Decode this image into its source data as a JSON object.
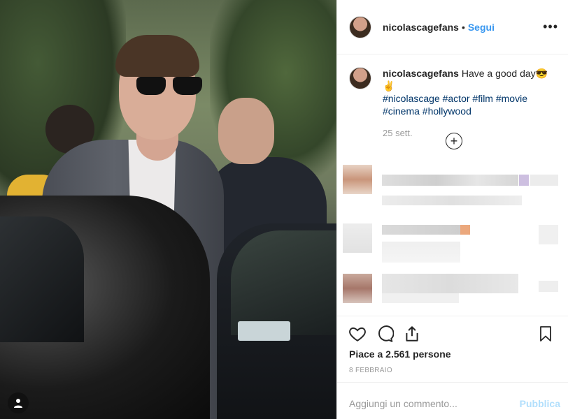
{
  "post": {
    "username": "nicolascagefans",
    "follow_dot": "•",
    "follow_label": "Segui",
    "more_label": "•••"
  },
  "caption": {
    "username": "nicolascagefans",
    "text": "Have a good day😎✌",
    "hashtags_line1": "#nicolascage #actor #film #movie",
    "hashtags_line2": "#cinema #hollywood",
    "date": "25 sett."
  },
  "engagement": {
    "likes": "Piace a 2.561 persone",
    "post_date": "8 FEBBRAIO"
  },
  "comment_box": {
    "placeholder": "Aggiungi un commento...",
    "publish": "Pubblica"
  },
  "icons": {
    "user_tag": "user-tag-icon",
    "like": "heart-icon",
    "comment": "comment-icon",
    "share": "share-icon",
    "save": "bookmark-icon",
    "add": "plus-circle-icon"
  },
  "colors": {
    "link_blue": "#3897f0",
    "hashtag": "#003569",
    "muted": "#999999",
    "publish_disabled": "#b2dffc"
  }
}
